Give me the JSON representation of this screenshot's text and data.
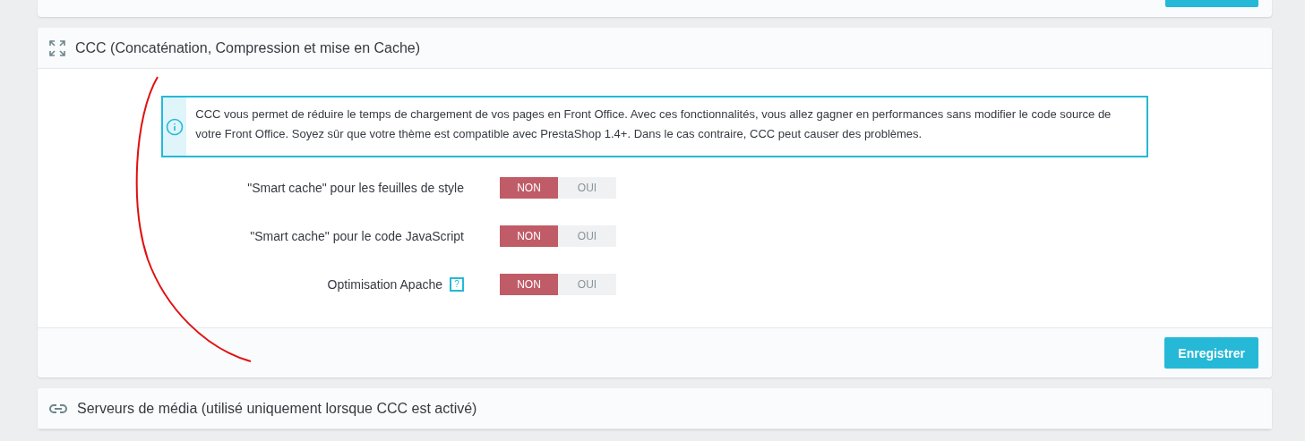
{
  "top_card": {
    "has_button": true
  },
  "ccc_panel": {
    "title": "CCC (Concaténation, Compression et mise en Cache)",
    "info": "CCC vous permet de réduire le temps de chargement de vos pages en Front Office. Avec ces fonctionnalités, vous allez gagner en performances sans modifier le code source de votre Front Office. Soyez sûr que votre thème est compatible avec PrestaShop 1.4+. Dans le cas contraire, CCC peut causer des problèmes.",
    "settings": [
      {
        "label": "\"Smart cache\" pour les feuilles de style",
        "options": [
          {
            "label": "NON",
            "selected": true
          },
          {
            "label": "OUI",
            "selected": false
          }
        ]
      },
      {
        "label": "\"Smart cache\" pour le code JavaScript",
        "options": [
          {
            "label": "NON",
            "selected": true
          },
          {
            "label": "OUI",
            "selected": false
          }
        ]
      },
      {
        "label": "Optimisation Apache",
        "help": "?",
        "options": [
          {
            "label": "NON",
            "selected": true
          },
          {
            "label": "OUI",
            "selected": false
          }
        ]
      }
    ],
    "save_button": "Enregistrer"
  },
  "media_panel": {
    "title": "Serveurs de média (utilisé uniquement lorsque CCC est activé)"
  }
}
